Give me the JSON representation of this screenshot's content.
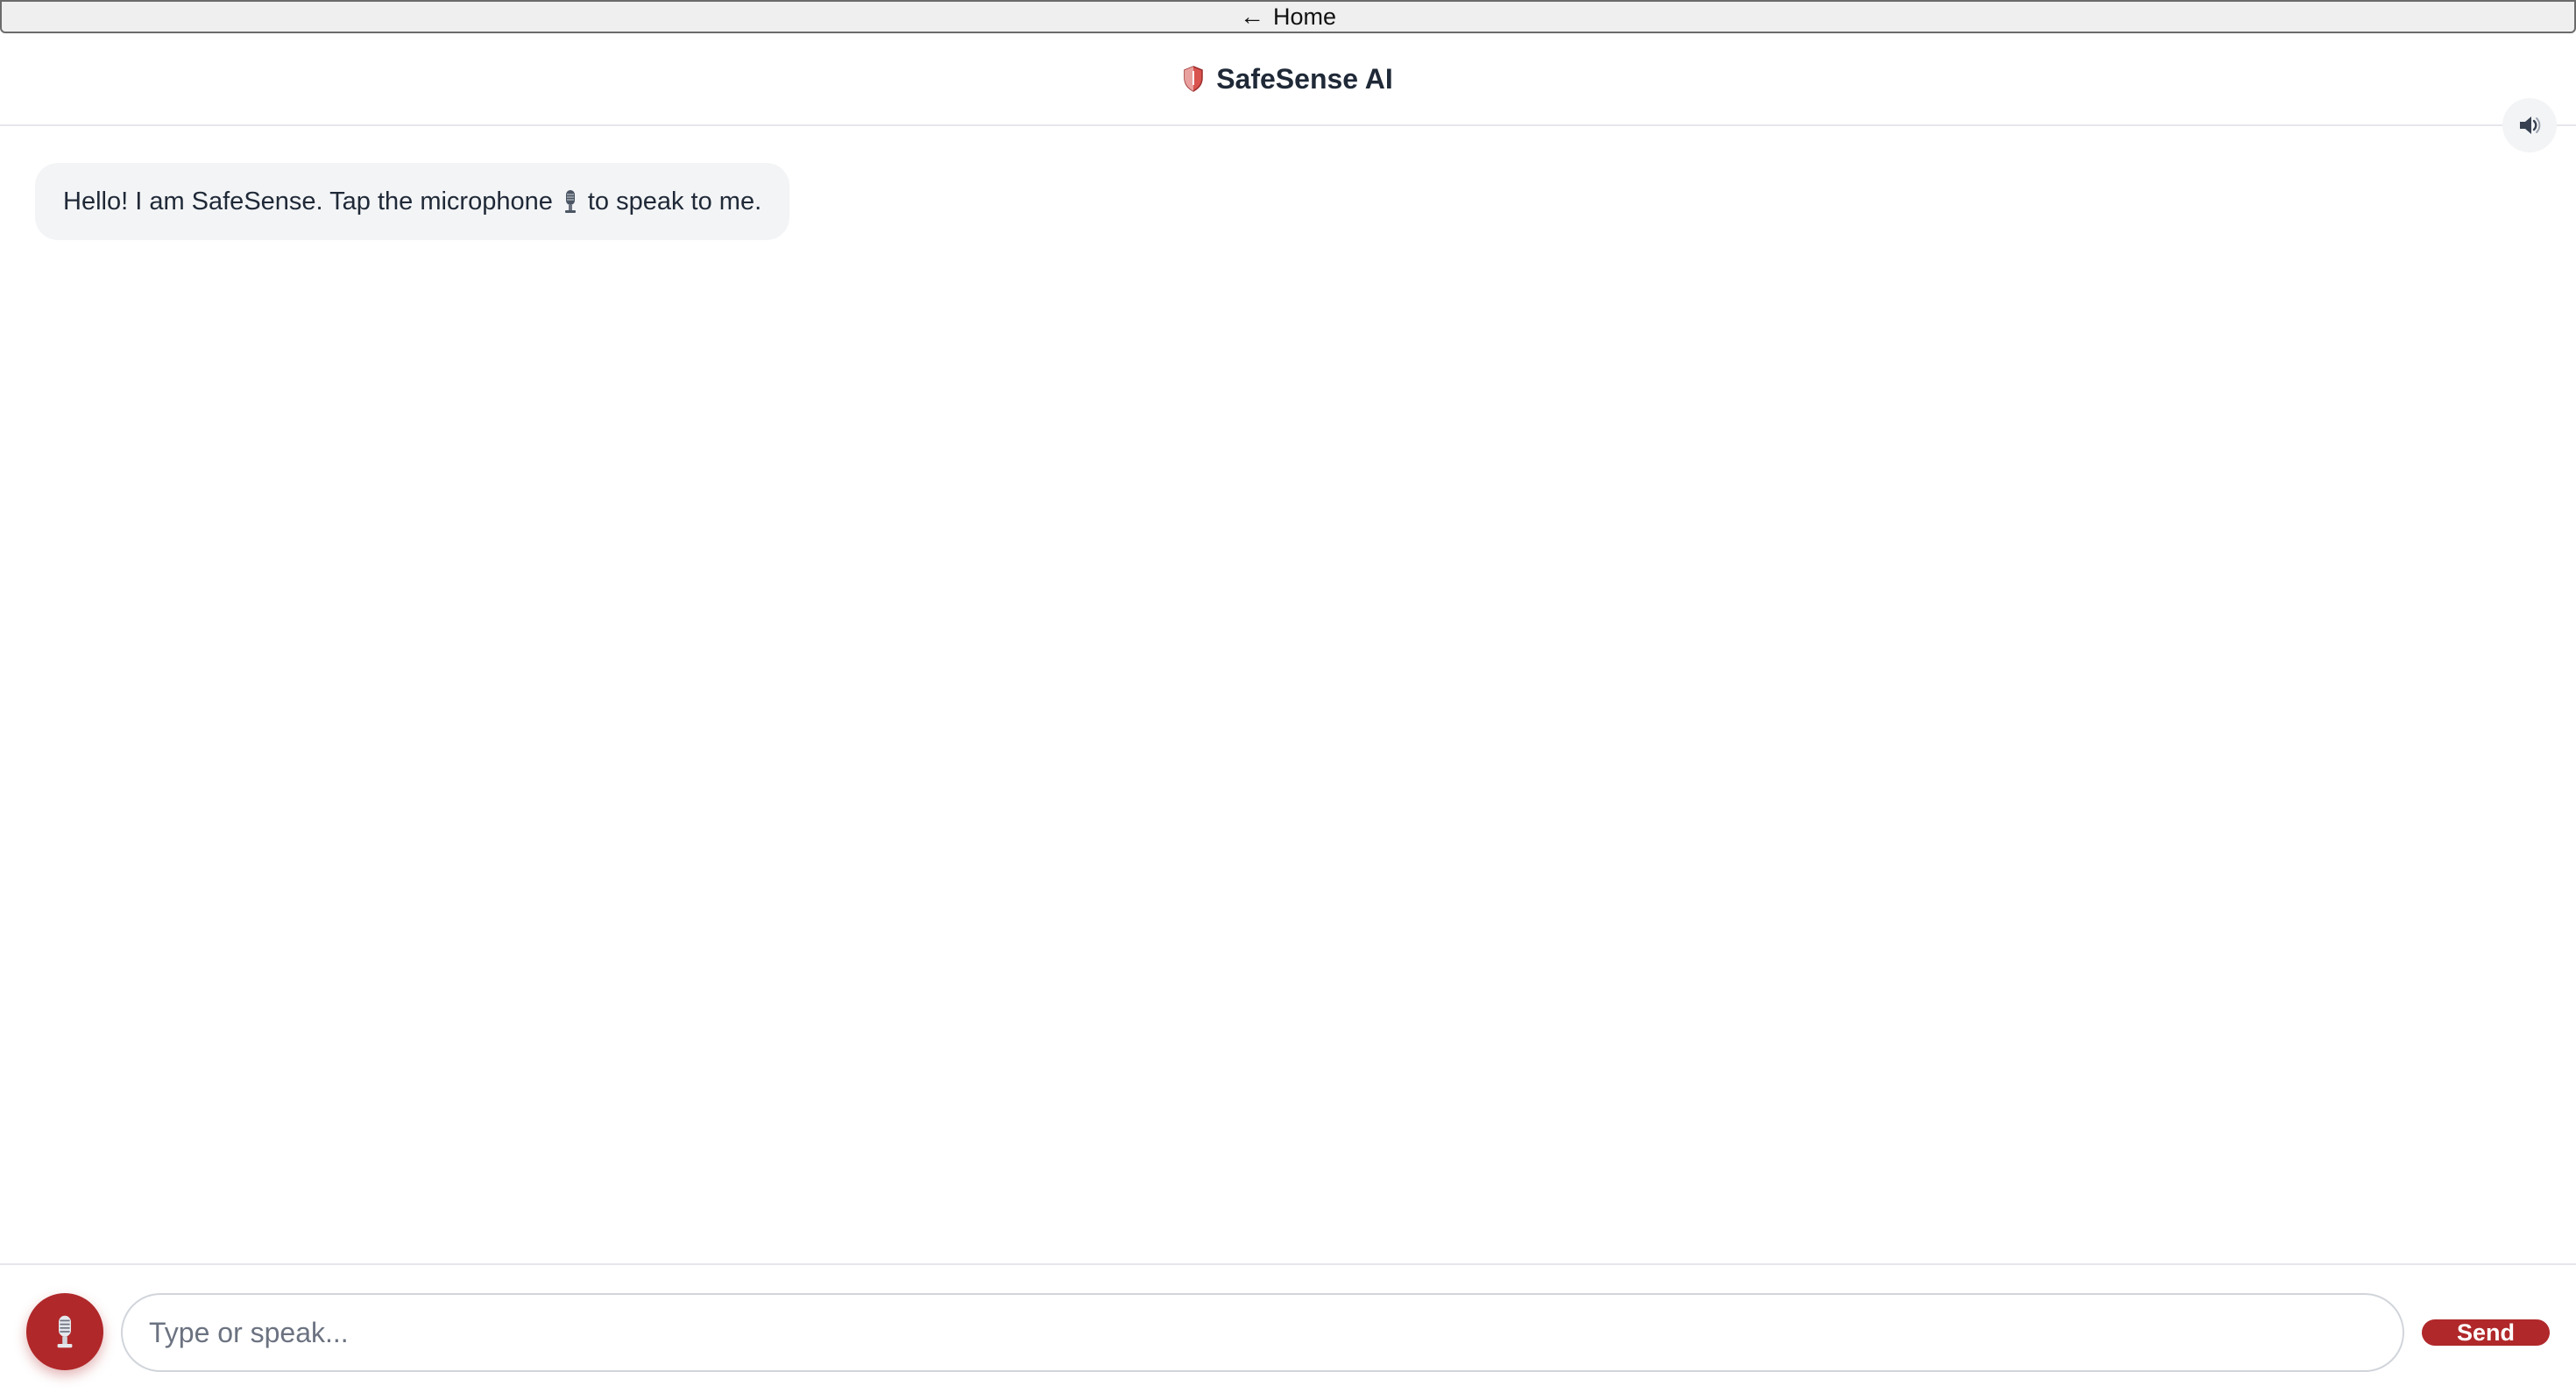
{
  "home_bar": {
    "arrow": "←",
    "label": "Home"
  },
  "header": {
    "title": "SafeSense AI",
    "logo_icon": "shield-icon",
    "sound_icon": "speaker-icon"
  },
  "chat": {
    "messages": [
      {
        "role": "assistant",
        "text_before_icon": "Hello! I am SafeSense. Tap the microphone",
        "inline_icon": "microphone-icon",
        "text_after_icon": "to speak to me."
      }
    ]
  },
  "footer": {
    "mic_icon": "microphone-icon",
    "input_value": "",
    "input_placeholder": "Type or speak...",
    "send_label": "Send"
  },
  "colors": {
    "accent": "#b0282a",
    "bubble_bg": "#f3f4f6",
    "border": "#e5e7eb",
    "text": "#1f2937"
  }
}
